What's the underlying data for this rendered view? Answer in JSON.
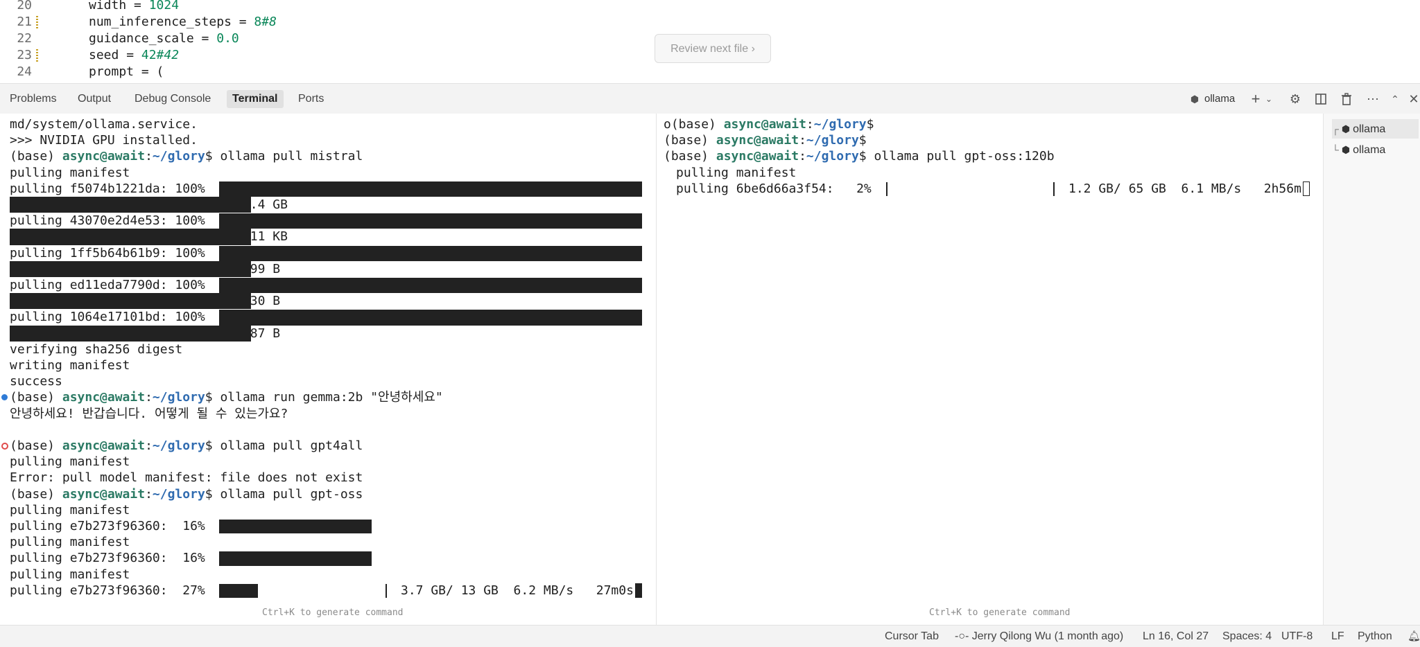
{
  "editor": {
    "lines": [
      {
        "num": "20",
        "modified": false,
        "indent": "    ",
        "name": "width",
        "op": " = ",
        "value": "1024",
        "comment": ""
      },
      {
        "num": "21",
        "modified": true,
        "indent": "    ",
        "name": "num_inference_steps",
        "op": " = ",
        "value": "8",
        "comment": "#8"
      },
      {
        "num": "22",
        "modified": false,
        "indent": "    ",
        "name": "guidance_scale",
        "op": " = ",
        "value": "0.0",
        "comment": ""
      },
      {
        "num": "23",
        "modified": true,
        "indent": "    ",
        "name": "seed",
        "op": " = ",
        "value": "42",
        "comment": "#42"
      },
      {
        "num": "24",
        "modified": false,
        "indent": "    ",
        "name": "prompt",
        "op": " = (",
        "value": "",
        "comment": ""
      }
    ],
    "review_button": "Review next file ›"
  },
  "panel": {
    "tabs": [
      "Problems",
      "Output",
      "Debug Console",
      "Terminal",
      "Ports"
    ],
    "active_tab": "Terminal",
    "terminal_name": "ollama",
    "icons": [
      "ollama-cube-icon",
      "plus-icon",
      "chevron-down-icon",
      "gear-icon",
      "split-icon",
      "trash-icon",
      "more-icon",
      "chevron-up-icon",
      "close-icon"
    ]
  },
  "terminal_left": {
    "lines": [
      {
        "text": "md/system/ollama.service."
      },
      {
        "text": ">>> NVIDIA GPU installed."
      },
      {
        "prompt": "(base) ",
        "user": "async@await",
        "sep": ":",
        "path": "~/glory",
        "cmd": "$ ollama pull mistral"
      },
      {
        "text": "pulling manifest"
      },
      {
        "text": "pulling f5074b1221da: 100% "
      },
      {
        "text": "                               4.4 GB"
      },
      {
        "text": "pulling 43070e2d4e53: 100% "
      },
      {
        "text": "                                11 KB"
      },
      {
        "text": "pulling 1ff5b64b61b9: 100% "
      },
      {
        "text": "                               799 B"
      },
      {
        "text": "pulling ed11eda7790d: 100% "
      },
      {
        "text": "                                30 B"
      },
      {
        "text": "pulling 1064e17101bd: 100% "
      },
      {
        "text": "                               487 B"
      },
      {
        "text": "verifying sha256 digest"
      },
      {
        "text": "writing manifest"
      },
      {
        "text": "success"
      },
      {
        "prompt": "(base) ",
        "user": "async@await",
        "sep": ":",
        "path": "~/glory",
        "cmd": "$ ollama run gemma:2b \"안녕하세요\""
      },
      {
        "text": "안녕하세요! 반갑습니다. 어떻게 될 수 있는가요?"
      },
      {
        "text": ""
      },
      {
        "prompt": "(base) ",
        "user": "async@await",
        "sep": ":",
        "path": "~/glory",
        "cmd": "$ ollama pull gpt4all"
      },
      {
        "text": "pulling manifest"
      },
      {
        "text": "Error: pull model manifest: file does not exist"
      },
      {
        "prompt": "(base) ",
        "user": "async@await",
        "sep": ":",
        "path": "~/glory",
        "cmd": "$ ollama pull gpt-oss"
      },
      {
        "text": "pulling manifest"
      },
      {
        "text": "pulling e7b273f96360:  16% "
      },
      {
        "text": "pulling manifest"
      },
      {
        "text": "pulling e7b273f96360:  16% "
      },
      {
        "text": "pulling manifest"
      },
      {
        "text": "pulling e7b273f96360:  27% "
      }
    ],
    "final_stats": "3.7 GB/ 13 GB  6.2 MB/s   27m0s",
    "progress": {
      "pull_gpt_oss_16_a": 0.16,
      "pull_gpt_oss_16_b": 0.16,
      "pull_gpt_oss_27": 0.27
    },
    "hint": "Ctrl+K to generate command"
  },
  "terminal_right": {
    "lines": [
      {
        "lead": "o",
        "prompt": "(base) ",
        "user": "async@await",
        "sep": ":",
        "path": "~/glory",
        "cmd": "$"
      },
      {
        "lead": "",
        "prompt": "(base) ",
        "user": "async@await",
        "sep": ":",
        "path": "~/glory",
        "cmd": "$"
      },
      {
        "lead": "",
        "prompt": "(base) ",
        "user": "async@await",
        "sep": ":",
        "path": "~/glory",
        "cmd": "$ ollama pull gpt-oss:120b"
      },
      {
        "text": "pulling manifest"
      },
      {
        "text": "pulling 6be6d66a3f54:   2% "
      }
    ],
    "final_stats": "1.2 GB/ 65 GB  6.1 MB/s   2h56m",
    "progress": 0.02,
    "hint": "Ctrl+K to generate command"
  },
  "terminal_list": {
    "items": [
      {
        "label": "ollama",
        "tree": "┌",
        "selected": true
      },
      {
        "label": "ollama",
        "tree": "└",
        "selected": false
      }
    ]
  },
  "statusbar": {
    "cursor_tab": "Cursor Tab",
    "blame": "-○- Jerry Qilong Wu (1 month ago)",
    "position": "Ln 16, Col 27",
    "spaces": "Spaces: 4",
    "encoding": "UTF-8",
    "eol": "LF",
    "language": "Python"
  },
  "colors": {
    "user": "#2b7a64",
    "path": "#2f6bb0",
    "success_dot": "#2f7bd6",
    "error_dot": "#e04a4a",
    "bar": "#222222"
  }
}
